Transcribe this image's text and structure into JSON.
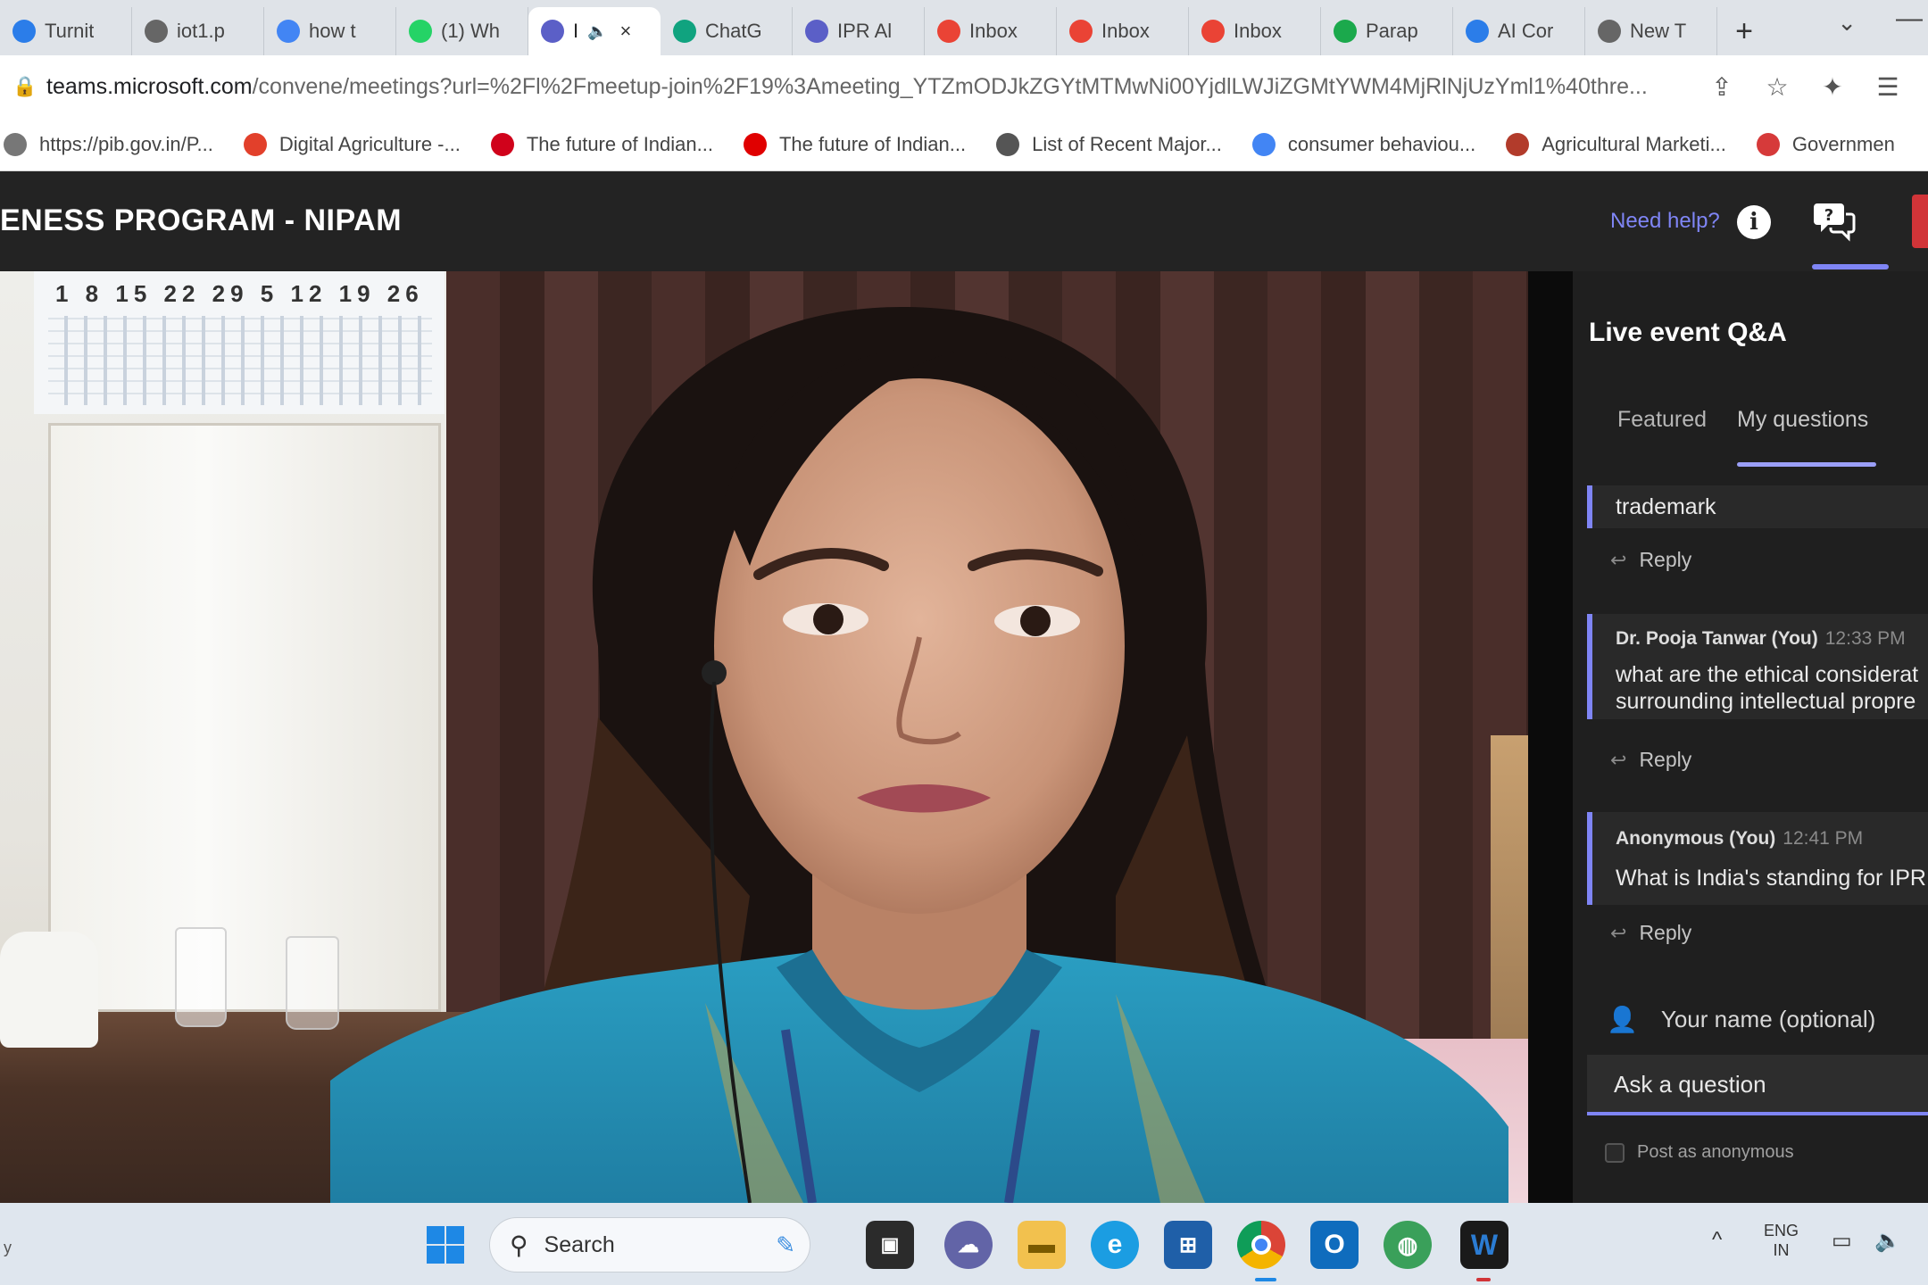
{
  "browser": {
    "tabs": [
      {
        "label": "Turnit",
        "color": "#2b7de9"
      },
      {
        "label": "iot1.p",
        "color": "#666666"
      },
      {
        "label": "how t",
        "color": "#4285f4"
      },
      {
        "label": "(1) Wh",
        "color": "#25d366"
      },
      {
        "label": "I",
        "color": "#5b5fc7",
        "active": true
      },
      {
        "label": "ChatG",
        "color": "#10a37f"
      },
      {
        "label": "IPR Al",
        "color": "#5b5fc7"
      },
      {
        "label": "Inbox",
        "color": "#ea4335"
      },
      {
        "label": "Inbox",
        "color": "#ea4335"
      },
      {
        "label": "Inbox",
        "color": "#ea4335"
      },
      {
        "label": "Parap",
        "color": "#1ba94c"
      },
      {
        "label": "AI Cor",
        "color": "#2b7de9"
      },
      {
        "label": "New T",
        "color": "#666666"
      }
    ],
    "url_domain": "teams.microsoft.com",
    "url_path": "/convene/meetings?url=%2Fl%2Fmeetup-join%2F19%3Ameeting_YTZmODJkZGYtMTMwNi00YjdlLWJiZGMtYWM4MjRlNjUzYml1%40thre...",
    "bookmarks": [
      {
        "label": "https://pib.gov.in/P...",
        "color": "#777777"
      },
      {
        "label": "Digital Agriculture -...",
        "color": "#e2402b"
      },
      {
        "label": "The future of Indian...",
        "color": "#d0021b"
      },
      {
        "label": "The future of Indian...",
        "color": "#e00000"
      },
      {
        "label": "List of Recent Major...",
        "color": "#555555"
      },
      {
        "label": "consumer behaviou...",
        "color": "#4285f4"
      },
      {
        "label": "Agricultural Marketi...",
        "color": "#b23b2b"
      },
      {
        "label": "Governmen",
        "color": "#d63a3a"
      }
    ]
  },
  "teams": {
    "title": "ENESS PROGRAM - NIPAM",
    "help_label": "Need help?",
    "info_glyph": "i",
    "accent": "#7f85f5"
  },
  "video": {
    "calendar_numbers": "1 8 15 22 29 5 12 19 26"
  },
  "qa": {
    "title": "Live event Q&A",
    "tabs": [
      "Featured",
      "My questions"
    ],
    "questions": [
      {
        "author": "",
        "time": "",
        "text": [
          "trademark"
        ],
        "reply": "Reply"
      },
      {
        "author": "Dr. Pooja Tanwar (You)",
        "time": "12:33 PM",
        "text": [
          "what are the ethical considerat",
          "surrounding intellectual propre"
        ],
        "reply": "Reply"
      },
      {
        "author": "Anonymous (You)",
        "time": "12:41 PM",
        "text": [
          "What is India's standing for IPR"
        ],
        "reply": "Reply"
      }
    ],
    "name_placeholder": "Your name (optional)",
    "ask_placeholder": "Ask a question",
    "anon_label": "Post as anonymous"
  },
  "taskbar": {
    "left_text": "y",
    "search_label": "Search",
    "lang_top": "ENG",
    "lang_bottom": "IN",
    "apps": [
      "windows-start",
      "task-view",
      "teams-chat",
      "file-explorer",
      "edge",
      "microsoft-store",
      "chrome",
      "outlook",
      "web-browser",
      "word"
    ]
  }
}
